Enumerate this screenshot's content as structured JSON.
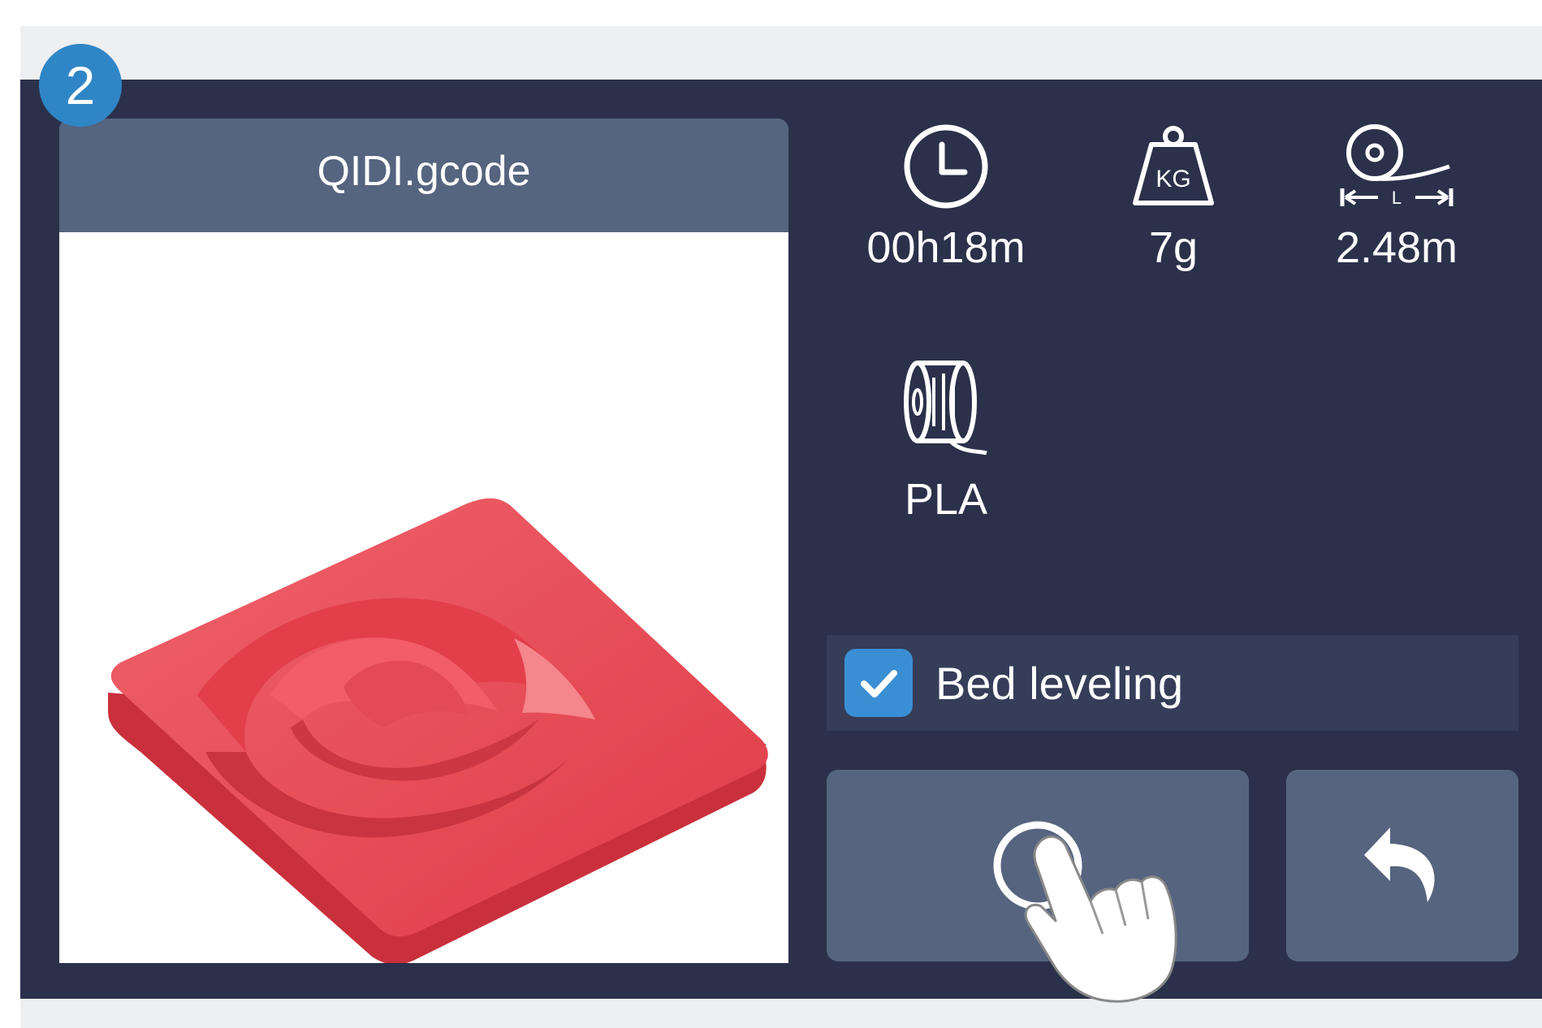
{
  "step_badge": "2",
  "preview": {
    "filename": "QIDI.gcode"
  },
  "stats": {
    "time": {
      "value": "00h18m",
      "icon": "clock-icon"
    },
    "weight": {
      "value": "7g",
      "icon": "weight-icon",
      "icon_text": "KG"
    },
    "length": {
      "value": "2.48m",
      "icon": "filament-length-icon",
      "icon_text": "L"
    },
    "material": {
      "value": "PLA",
      "icon": "spool-icon"
    }
  },
  "bed_leveling": {
    "label": "Bed leveling",
    "checked": true
  },
  "buttons": {
    "start": {
      "icon": "start-print-icon"
    },
    "back": {
      "icon": "back-arrow-icon"
    }
  },
  "colors": {
    "screen_bg": "#2b314a",
    "panel": "#56647f",
    "checkbox": "#3a8fd4",
    "badge": "#2f86c7",
    "model": "#e8505b"
  }
}
